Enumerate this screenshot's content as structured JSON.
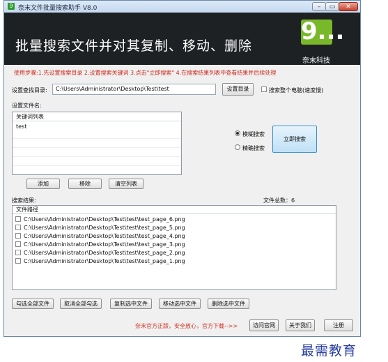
{
  "window": {
    "title": "奈末文件批量搜索助手 V8.0",
    "app_icon": "9"
  },
  "banner": {
    "title": "批量搜索文件并对其复制、移动、删除",
    "logo_mark": "9...",
    "company": "奈末科技"
  },
  "steps_text": "使用步骤:1.先设置搜索目录 2.设置搜索关键词 3.点击\"立即搜索\" 4.在搜索结果列表中查看结果并后续处理",
  "search_dir": {
    "label": "设置查找目录:",
    "value": "C:\\Users\\Administrator\\Desktop\\Test\\test",
    "set_button": "设置目录",
    "whole_pc_label": "搜索整个电脑(速度慢)"
  },
  "filename": {
    "label": "设置文件名:",
    "list_header": "关键词列表",
    "keywords": [
      "test"
    ],
    "add_button": "添加",
    "remove_button": "移除",
    "clear_button": "清空列表"
  },
  "search_mode": {
    "fuzzy_label": "模糊搜索",
    "exact_label": "精确搜索",
    "selected": "模糊搜索",
    "search_button": "立即搜索"
  },
  "results": {
    "label": "搜索结果:",
    "total": "文件总数：6",
    "column_header": "文件路径",
    "files": [
      "C:\\Users\\Administrator\\Desktop\\Test\\test\\test_page_6.png",
      "C:\\Users\\Administrator\\Desktop\\Test\\test\\test_page_5.png",
      "C:\\Users\\Administrator\\Desktop\\Test\\test\\test_page_4.png",
      "C:\\Users\\Administrator\\Desktop\\Test\\test\\test_page_3.png",
      "C:\\Users\\Administrator\\Desktop\\Test\\test\\test_page_2.png",
      "C:\\Users\\Administrator\\Desktop\\Test\\test\\test_page_1.png"
    ]
  },
  "actions": {
    "check_all": "勾选全部文件",
    "uncheck_all": "取消全部勾选",
    "copy": "复制选中文件",
    "move": "移动选中文件",
    "delete": "删除选中文件"
  },
  "footer": {
    "note": "奈末官方正版，安全放心，官方下载-->>",
    "visit_site": "访问官网",
    "about": "关于我们",
    "register": "注册"
  },
  "watermark": "最需教育",
  "colors": {
    "banner_bg": "#1e2124",
    "logo_green": "#79b929",
    "steps_red": "#cc2a1d",
    "watermark_blue": "#2a3ea0"
  }
}
